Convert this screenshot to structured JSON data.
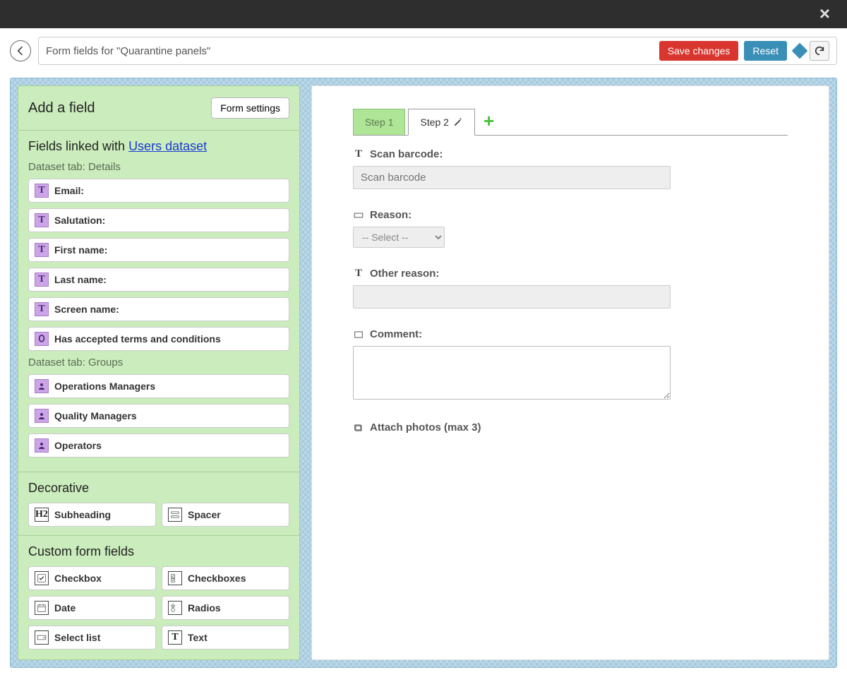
{
  "topbar": {
    "close_icon": "×"
  },
  "header": {
    "title": "Form fields for \"Quarantine panels\"",
    "save_label": "Save changes",
    "reset_label": "Reset"
  },
  "left": {
    "add_field_title": "Add a field",
    "form_settings_label": "Form settings",
    "linked_title_prefix": "Fields linked with ",
    "linked_dataset_name": "Users dataset",
    "details_tab_label": "Dataset tab: Details",
    "details_fields": [
      {
        "icon": "T",
        "label": "Email:"
      },
      {
        "icon": "T",
        "label": "Salutation:"
      },
      {
        "icon": "T",
        "label": "First name:"
      },
      {
        "icon": "T",
        "label": "Last name:"
      },
      {
        "icon": "T",
        "label": "Screen name:"
      },
      {
        "icon": "fingerprint",
        "label": "Has accepted terms and conditions"
      }
    ],
    "groups_tab_label": "Dataset tab: Groups",
    "groups_fields": [
      {
        "icon": "person",
        "label": "Operations Managers"
      },
      {
        "icon": "person",
        "label": "Quality Managers"
      },
      {
        "icon": "person",
        "label": "Operators"
      }
    ],
    "decorative_title": "Decorative",
    "decorative_items": [
      {
        "icon": "H2",
        "label": "Subheading"
      },
      {
        "icon": "spacer",
        "label": "Spacer"
      }
    ],
    "custom_title": "Custom form fields",
    "custom_items": [
      {
        "icon": "checkbox",
        "label": "Checkbox"
      },
      {
        "icon": "checkboxes",
        "label": "Checkboxes"
      },
      {
        "icon": "calendar",
        "label": "Date"
      },
      {
        "icon": "radios",
        "label": "Radios"
      },
      {
        "icon": "select",
        "label": "Select list"
      },
      {
        "icon": "T",
        "label": "Text"
      }
    ]
  },
  "right": {
    "tabs": [
      {
        "label": "Step 1",
        "active": false
      },
      {
        "label": "Step 2",
        "active": true
      }
    ],
    "fields": {
      "scan_barcode": {
        "label": "Scan barcode:",
        "placeholder": "Scan barcode"
      },
      "reason": {
        "label": "Reason:",
        "selected": "-- Select --"
      },
      "other_reason": {
        "label": "Other reason:"
      },
      "comment": {
        "label": "Comment:"
      },
      "attach_photos": {
        "label": "Attach photos (max 3)"
      }
    }
  }
}
